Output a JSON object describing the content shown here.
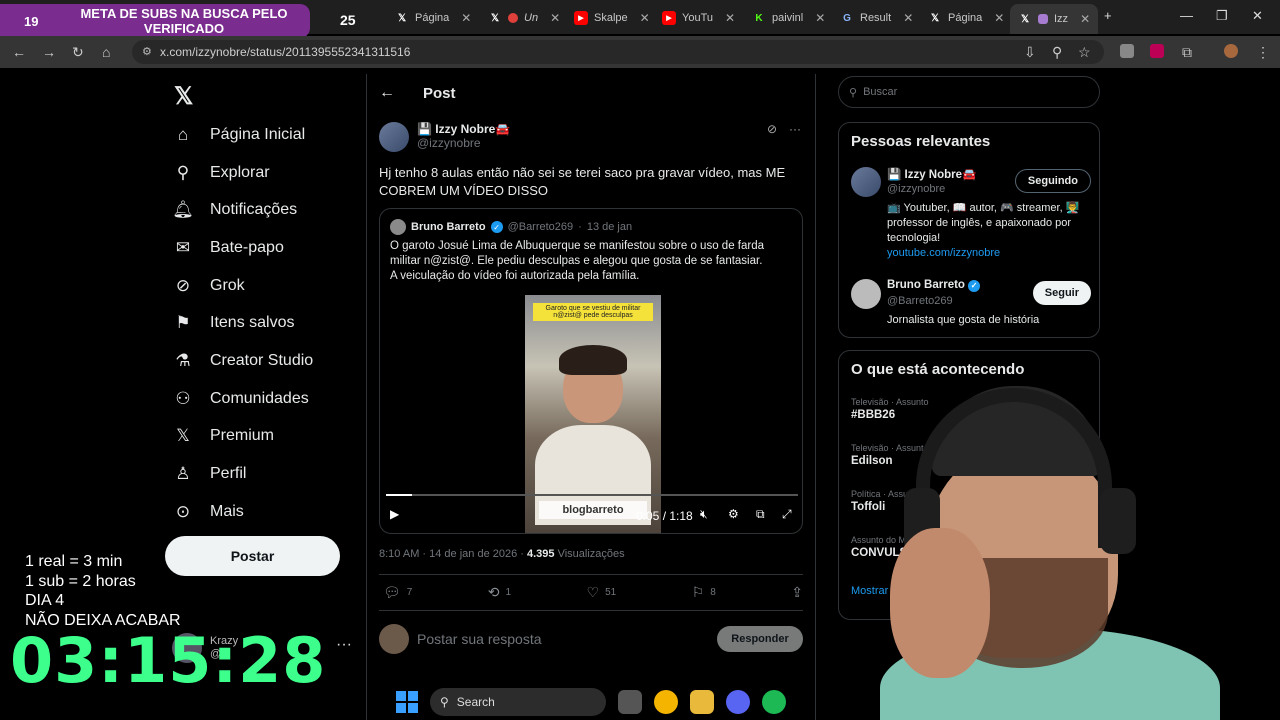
{
  "stream_overlay": {
    "goal_number": "19",
    "goal_text": "META DE SUBS NA BUSCA PELO VERIFICADO",
    "count": "25",
    "lines": [
      "1 real = 3 min",
      "1 sub = 2 horas",
      "DIA 4",
      "NÃO DEIXA ACABAR"
    ],
    "timer": "03:15:28"
  },
  "browser": {
    "tabs": [
      {
        "label": "Página",
        "icon": "x-icon"
      },
      {
        "label": "Un",
        "icon": "reddit-icon"
      },
      {
        "label": "Skalpe",
        "icon": "youtube-icon"
      },
      {
        "label": "YouTu",
        "icon": "youtube-icon"
      },
      {
        "label": "paivinl",
        "icon": "kick-icon"
      },
      {
        "label": "Result",
        "icon": "google-icon"
      },
      {
        "label": "Página",
        "icon": "x-icon"
      },
      {
        "label": "Izz",
        "icon": "x-icon"
      }
    ],
    "url": "x.com/izzynobre/status/2011395552341311516"
  },
  "nav": {
    "items": [
      {
        "label": "Página Inicial",
        "icon": "home-icon"
      },
      {
        "label": "Explorar",
        "icon": "search-icon"
      },
      {
        "label": "Notificações",
        "icon": "bell-icon"
      },
      {
        "label": "Bate-papo",
        "icon": "mail-icon"
      },
      {
        "label": "Grok",
        "icon": "grok-icon"
      },
      {
        "label": "Itens salvos",
        "icon": "bookmark-icon"
      },
      {
        "label": "Creator Studio",
        "icon": "flask-icon"
      },
      {
        "label": "Comunidades",
        "icon": "people-icon"
      },
      {
        "label": "Premium",
        "icon": "x-icon"
      },
      {
        "label": "Perfil",
        "icon": "person-icon"
      },
      {
        "label": "Mais",
        "icon": "more-icon"
      }
    ],
    "post_button": "Postar",
    "account": {
      "name": "Krazy",
      "handle": "@..."
    }
  },
  "post": {
    "header": "Post",
    "author_name": "💾 Izzy Nobre🚘",
    "author_handle": "@izzynobre",
    "text": "Hj tenho 8 aulas então não sei se terei saco pra gravar vídeo, mas ME COBREM UM VÍDEO DISSO",
    "quote": {
      "name": "Bruno Barreto",
      "handle": "@Barreto269",
      "date": "13 de jan",
      "text": "O garoto Josué Lima de Albuquerque se manifestou sobre o uso de farda militar n@zist@. Ele pediu desculpas e alegou que gosta de se fantasiar.\nA veiculação do vídeo foi autorizada pela família.",
      "video_caption": "Garoto que se vestiu de militar n@zist@ pede desculpas",
      "video_watermark": "blogbarreto",
      "video_time": "0:05 / 1:18",
      "progress": 0.064
    },
    "timestamp": "8:10 AM · 14 de jan de 2026 · ",
    "views_count": "4.395",
    "views_label": " Visualizações",
    "stats": {
      "replies": "7",
      "reposts": "1",
      "likes": "51",
      "bookmarks": "8"
    },
    "reply_placeholder": "Postar sua resposta",
    "reply_button": "Responder"
  },
  "sidebar": {
    "search_placeholder": "Buscar",
    "relevant_title": "Pessoas relevantes",
    "people": [
      {
        "name": "💾 Izzy Nobre🚘",
        "handle": "@izzynobre",
        "bio": "📺 Youtuber, 📖 autor, 🎮 streamer, 👨‍🏫 professor de inglês, e apaixonado por tecnologia!",
        "link": "youtube.com/izzynobre",
        "button": "Seguindo"
      },
      {
        "name": "Bruno Barreto",
        "handle": "@Barreto269",
        "bio": "Jornalista que gosta de história",
        "button": "Seguir"
      }
    ],
    "trends_title": "O que está acontecendo",
    "trends": [
      {
        "category": "Televisão · Assunto",
        "name": "#BBB26"
      },
      {
        "category": "Televisão · Assunto",
        "name": "Edilson"
      },
      {
        "category": "Política · Assunt",
        "name": "Toffoli"
      },
      {
        "category": "Assunto do Mo",
        "name": "CONVULSÃ"
      }
    ],
    "show_more": "Mostrar m"
  },
  "taskbar": {
    "search": "Search"
  },
  "colors": {
    "accent": "#1d9bf0",
    "timer": "#3cff8c",
    "banner": "#7a2c8f"
  }
}
